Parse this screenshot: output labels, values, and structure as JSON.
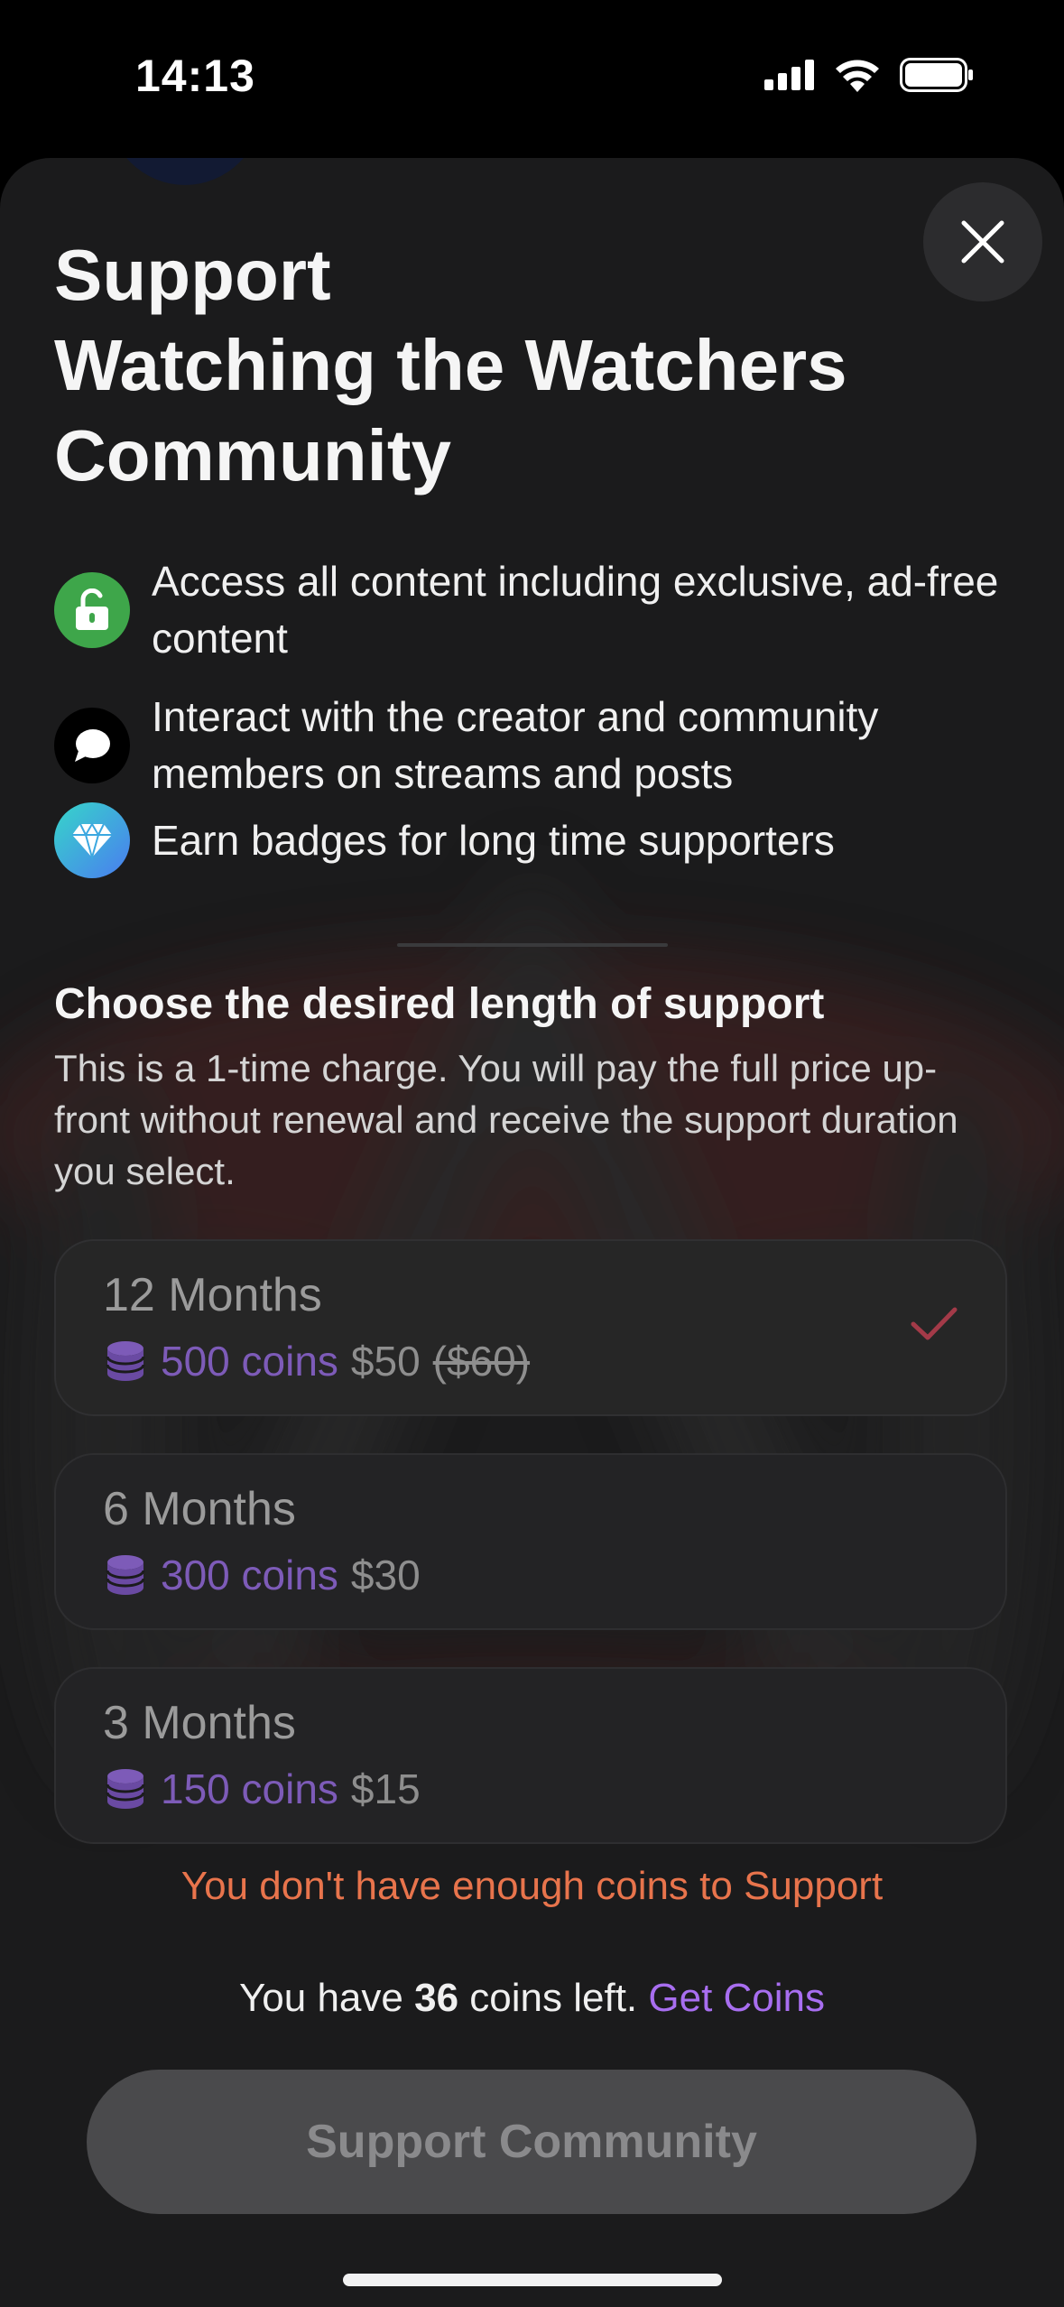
{
  "status_bar": {
    "time": "14:13"
  },
  "modal": {
    "title_lines": [
      "Support",
      "Watching the Watchers",
      "Community"
    ],
    "benefits": [
      {
        "icon": "unlock-icon",
        "color": "#3ea64a",
        "text": "Access all content including exclusive, ad-free content"
      },
      {
        "icon": "chat-bubble-icon",
        "color": "#000000",
        "text": "Interact with the creator and community members on streams and posts"
      },
      {
        "icon": "diamond-badge-icon",
        "color": "#3ac6e8",
        "text": "Earn badges for long time supporters"
      }
    ],
    "section_title": "Choose the desired length of support",
    "section_description": "This is a 1-time charge. You will pay the full price up-front without renewal and receive the support duration you select.",
    "options": [
      {
        "duration": "12 Months",
        "coins": "500 coins",
        "price": "$50",
        "old_price": "($60)",
        "selected": true
      },
      {
        "duration": "6 Months",
        "coins": "300 coins",
        "price": "$30",
        "selected": false
      },
      {
        "duration": "3 Months",
        "coins": "150 coins",
        "price": "$15",
        "selected": false
      }
    ],
    "warning": "You don't have enough coins to Support",
    "balance": {
      "prefix": "You have",
      "amount": "36",
      "suffix": "coins left.",
      "link": "Get Coins"
    },
    "cta_label": "Support Community",
    "colors": {
      "accent_purple": "#a86ef0",
      "coin_purple": "#7d5bb8",
      "warning_orange": "#e8744c",
      "check_red": "#a33a48"
    }
  }
}
